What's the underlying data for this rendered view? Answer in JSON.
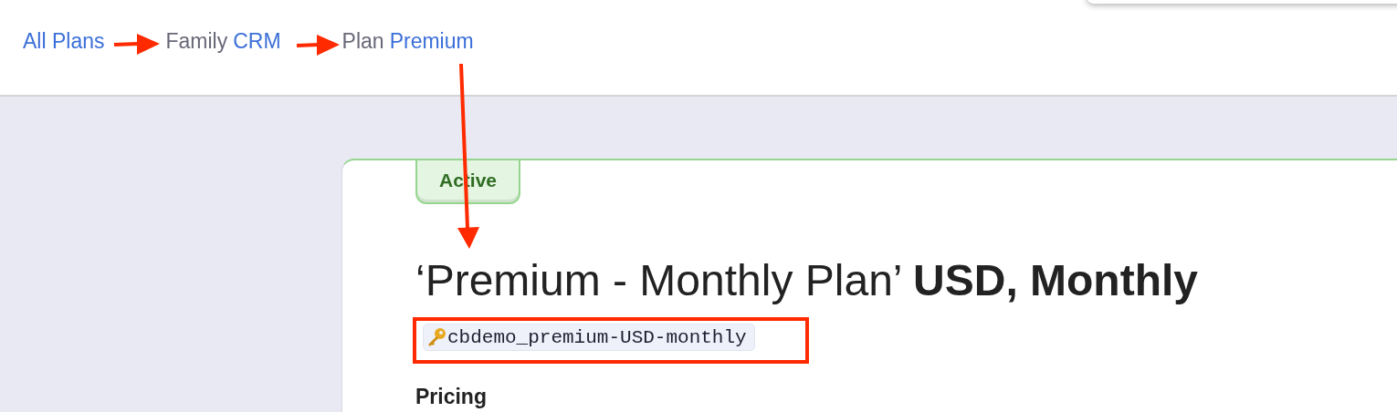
{
  "breadcrumb": [
    {
      "link": "All Plans"
    },
    {
      "prefix": "Family",
      "link": "CRM"
    },
    {
      "prefix": "Plan",
      "link": "Premium"
    }
  ],
  "plan": {
    "status": "Active",
    "title": "‘Premium - Monthly Plan’ **USD, Monthly**",
    "plan_id": "cbdemo_premium-USD-monthly"
  },
  "section_heading": "Pricing"
}
